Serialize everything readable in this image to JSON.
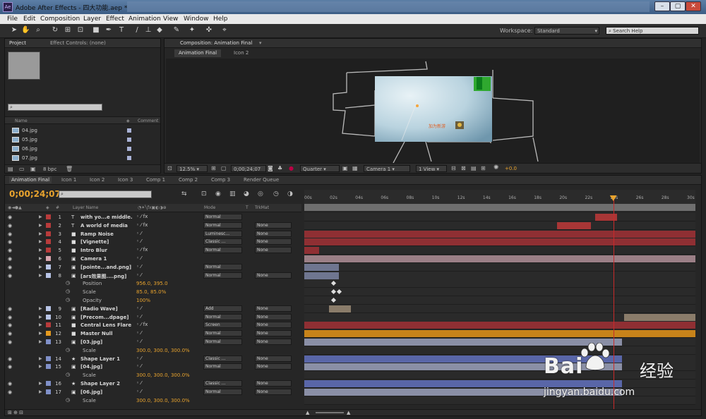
{
  "window": {
    "title": "Adobe After Effects - 四大功能.aep *",
    "app_icon_label": "Ae"
  },
  "menu": [
    "File",
    "Edit",
    "Composition",
    "Layer",
    "Effect",
    "Animation",
    "View",
    "Window",
    "Help"
  ],
  "toolbar": {
    "workspace_label": "Workspace:",
    "workspace_value": "Standard",
    "search_placeholder": "Search Help"
  },
  "project_panel": {
    "tab_project": "Project",
    "tab_effect_controls": "Effect Controls: (none)",
    "col_name": "Name",
    "col_comment": "Comment",
    "items": [
      "04.jpg",
      "05.jpg",
      "06.jpg",
      "07.jpg"
    ],
    "bpc": "8 bpc"
  },
  "comp_panel": {
    "tab": "Composition: Animation Final",
    "subtabs": [
      "Animation Final",
      "Icon 2"
    ],
    "zoom": "12.5%",
    "time": "0;00;24;07",
    "resolution": "Quarter",
    "camera": "Camera 1",
    "view": "1 View",
    "exposure": "+0.0",
    "canvas_text": "加为新游"
  },
  "timeline": {
    "tabs": [
      "Animation Final",
      "Icon 1",
      "Icon 2",
      "Icon 3",
      "Comp 1",
      "Comp 2",
      "Comp 3",
      "Render Queue"
    ],
    "timecode": "0;00;24;07",
    "ruler_labels": [
      "00s",
      "02s",
      "04s",
      "06s",
      "08s",
      "10s",
      "12s",
      "14s",
      "16s",
      "18s",
      "20s",
      "22s",
      "24s",
      "26s",
      "28s",
      "30s"
    ],
    "col_headers": {
      "num": "#",
      "layer_name": "Layer Name",
      "mode": "Mode",
      "t": "T",
      "trkmat": "TrkMat"
    },
    "rows": [
      {
        "type": "layer",
        "num": "1",
        "name": "with yo...e middle.",
        "icon": "T",
        "color": "#b83b3b",
        "mode": "Normal",
        "trk": "",
        "fx": true,
        "bar": {
          "start": 0.743,
          "end": 0.8,
          "color": "#a83636"
        }
      },
      {
        "type": "layer",
        "num": "2",
        "name": "A world of media",
        "icon": "T",
        "color": "#b83b3b",
        "mode": "Normal",
        "trk": "None",
        "fx": true,
        "bar": {
          "start": 0.647,
          "end": 0.732,
          "color": "#a83636"
        }
      },
      {
        "type": "layer",
        "num": "3",
        "name": "Ramp Noise",
        "icon": "■",
        "color": "#b83b3b",
        "mode": "Luminesc...",
        "trk": "None",
        "fx": false,
        "bar": {
          "start": 0.0,
          "end": 1.0,
          "color": "#8f2f33"
        }
      },
      {
        "type": "layer",
        "num": "4",
        "name": "[Vignette]",
        "icon": "■",
        "color": "#b83b3b",
        "mode": "Classic ...",
        "trk": "None",
        "fx": false,
        "bar": {
          "start": 0.0,
          "end": 1.0,
          "color": "#8f2f33"
        }
      },
      {
        "type": "layer",
        "num": "5",
        "name": "Intro Blur",
        "icon": "■",
        "color": "#b83b3b",
        "mode": "Normal",
        "trk": "None",
        "fx": true,
        "bar": {
          "start": 0.0,
          "end": 0.038,
          "color": "#8f2f33"
        }
      },
      {
        "type": "layer",
        "num": "6",
        "name": "Camera 1",
        "icon": "▣",
        "color": "#d9a7b0",
        "mode": "",
        "trk": "",
        "fx": false,
        "bar": {
          "start": 0.0,
          "end": 1.0,
          "color": "#9b7f86"
        }
      },
      {
        "type": "layer",
        "num": "7",
        "name": "[pointe...and.png]",
        "icon": "▣",
        "color": "#b8c4e6",
        "mode": "Normal",
        "trk": "",
        "fx": false,
        "bar": {
          "start": 0.0,
          "end": 0.088,
          "color": "#6f7690"
        }
      },
      {
        "type": "layer",
        "num": "8",
        "name": "[ars效果图....png]",
        "icon": "▣",
        "color": "#b8c4e6",
        "mode": "Normal",
        "trk": "None",
        "fx": false,
        "bar": {
          "start": 0.0,
          "end": 0.088,
          "color": "#6f7690"
        }
      },
      {
        "type": "prop",
        "name": "Position",
        "value": "956.0, 395.0",
        "kf": [
          0.07
        ]
      },
      {
        "type": "prop",
        "name": "Scale",
        "value": "85.0, 85.0%",
        "kf": [
          0.07,
          0.085
        ]
      },
      {
        "type": "prop",
        "name": "Opacity",
        "value": "100%",
        "kf": [
          0.07
        ]
      },
      {
        "type": "layer",
        "num": "9",
        "name": "[Radio Wave]",
        "icon": "▣",
        "color": "#b8c4e6",
        "mode": "Add",
        "trk": "None",
        "fx": false,
        "bar": {
          "start": 0.063,
          "end": 0.12,
          "color": "#8a7c6a"
        }
      },
      {
        "type": "layer",
        "num": "10",
        "name": "[Precom...dpage]",
        "icon": "▣",
        "color": "#b8c4e6",
        "mode": "Normal",
        "trk": "None",
        "fx": false,
        "bar": {
          "start": 0.818,
          "end": 1.0,
          "color": "#8a7c6a"
        }
      },
      {
        "type": "layer",
        "num": "11",
        "name": "Central Lens Flare",
        "icon": "■",
        "color": "#b83b3b",
        "mode": "Screen",
        "trk": "None",
        "fx": true,
        "bar": {
          "start": 0.0,
          "end": 1.0,
          "color": "#8f2f33"
        }
      },
      {
        "type": "layer",
        "num": "12",
        "name": "Master Null",
        "icon": "■",
        "color": "#e59a1f",
        "mode": "Normal",
        "trk": "None",
        "fx": false,
        "bar": {
          "start": 0.0,
          "end": 1.0,
          "color": "#c7831a"
        }
      },
      {
        "type": "layer",
        "num": "13",
        "name": "[03.jpg]",
        "icon": "▣",
        "color": "#8090c8",
        "mode": "Normal",
        "trk": "None",
        "fx": false,
        "bar": {
          "start": 0.0,
          "end": 0.812,
          "color": "#8a8fa6"
        }
      },
      {
        "type": "prop",
        "name": "Scale",
        "value": "300.0, 300.0, 300.0%",
        "kf": []
      },
      {
        "type": "layer",
        "num": "14",
        "name": "Shape Layer 1",
        "icon": "★",
        "color": "#8090c8",
        "mode": "Classic ...",
        "trk": "None",
        "fx": false,
        "bar": {
          "start": 0.0,
          "end": 0.812,
          "color": "#5966a8"
        }
      },
      {
        "type": "layer",
        "num": "15",
        "name": "[04.jpg]",
        "icon": "▣",
        "color": "#8090c8",
        "mode": "Normal",
        "trk": "None",
        "fx": false,
        "bar": {
          "start": 0.0,
          "end": 0.812,
          "color": "#8a8fa6"
        }
      },
      {
        "type": "prop",
        "name": "Scale",
        "value": "300.0, 300.0, 300.0%",
        "kf": []
      },
      {
        "type": "layer",
        "num": "16",
        "name": "Shape Layer 2",
        "icon": "★",
        "color": "#8090c8",
        "mode": "Classic ...",
        "trk": "None",
        "fx": false,
        "bar": {
          "start": 0.0,
          "end": 0.812,
          "color": "#5966a8"
        }
      },
      {
        "type": "layer",
        "num": "17",
        "name": "[06.jpg]",
        "icon": "▣",
        "color": "#8090c8",
        "mode": "Normal",
        "trk": "None",
        "fx": false,
        "bar": {
          "start": 0.0,
          "end": 0.812,
          "color": "#8a8fa6"
        }
      },
      {
        "type": "prop",
        "name": "Scale",
        "value": "300.0, 300.0, 300.0%",
        "kf": []
      }
    ],
    "current_time_fraction": 0.79
  },
  "watermark": {
    "brand_left": "Bai",
    "brand_right": "经验",
    "url": "jingyan.baidu.com"
  }
}
